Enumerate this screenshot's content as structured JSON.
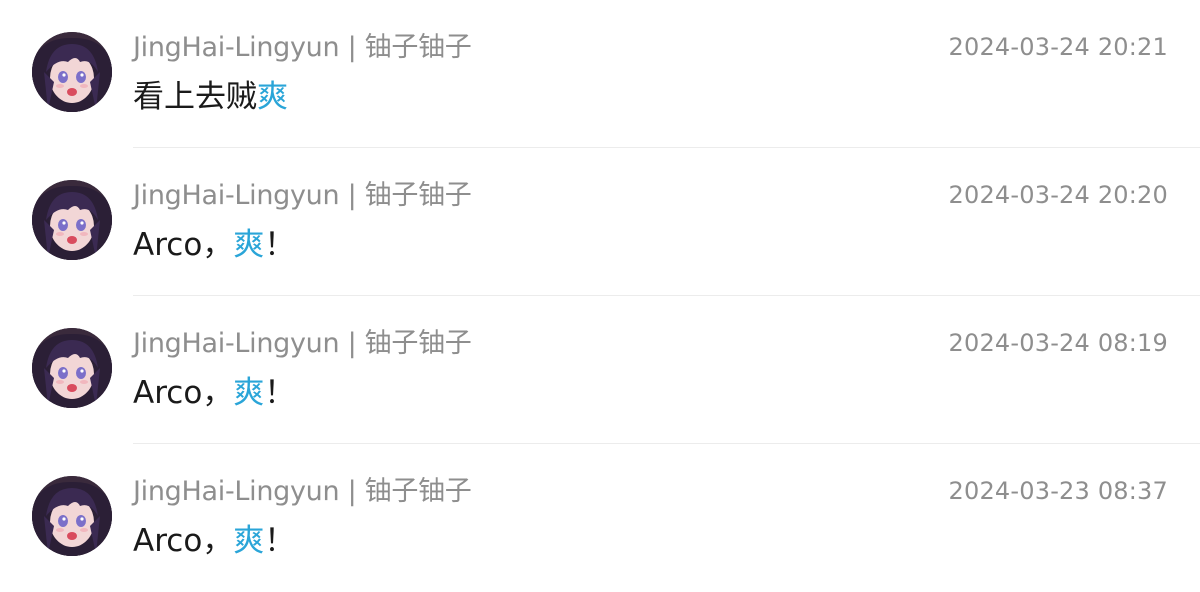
{
  "comments": [
    {
      "username": "JingHai-Lingyun | 铀子铀子",
      "timestamp": "2024-03-24 20:21",
      "message_prefix": "看上去贼",
      "message_emote": "爽",
      "message_suffix": ""
    },
    {
      "username": "JingHai-Lingyun | 铀子铀子",
      "timestamp": "2024-03-24 20:20",
      "message_prefix": "Arco，",
      "message_emote": "爽",
      "message_suffix": "！"
    },
    {
      "username": "JingHai-Lingyun | 铀子铀子",
      "timestamp": "2024-03-24 08:19",
      "message_prefix": "Arco，",
      "message_emote": "爽",
      "message_suffix": "！"
    },
    {
      "username": "JingHai-Lingyun | 铀子铀子",
      "timestamp": "2024-03-23 08:37",
      "message_prefix": "Arco，",
      "message_emote": "爽",
      "message_suffix": "！"
    }
  ],
  "colors": {
    "emote_highlight": "#2aa5d8",
    "meta_text": "#8e8e8e",
    "message_text": "#1a1a1a"
  },
  "icons": {
    "avatar": "anime-girl-avatar"
  }
}
